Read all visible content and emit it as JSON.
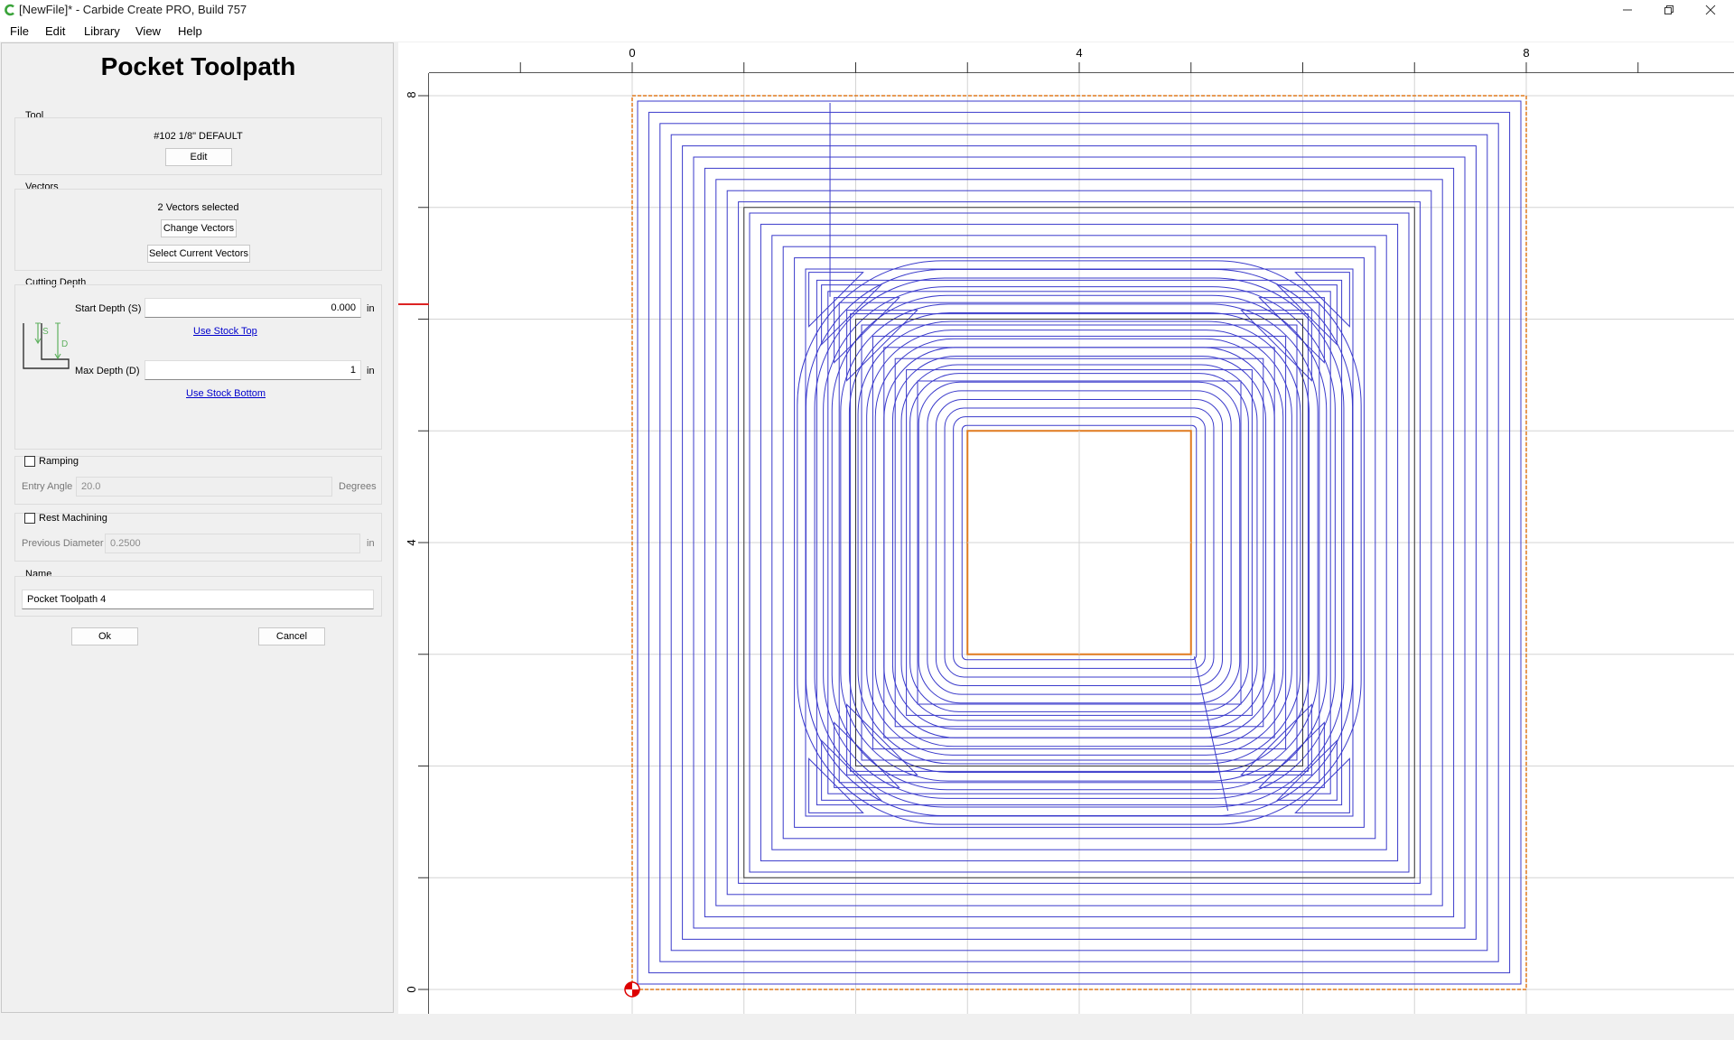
{
  "window": {
    "title": "[NewFile]* - Carbide Create PRO, Build 757",
    "controls": [
      "minimize",
      "restore",
      "close"
    ]
  },
  "menu": {
    "items": [
      "File",
      "Edit",
      "Library",
      "View",
      "Help"
    ]
  },
  "panel": {
    "title": "Pocket Toolpath",
    "tool": {
      "group_label": "Tool",
      "name": "#102 1/8\" DEFAULT",
      "edit_label": "Edit"
    },
    "vectors": {
      "group_label": "Vectors",
      "status": "2 Vectors selected",
      "change_label": "Change Vectors",
      "select_current_label": "Select Current Vectors"
    },
    "cutting_depth": {
      "group_label": "Cutting Depth",
      "start_label": "Start Depth (S)",
      "start_value": "0.000",
      "start_unit": "in",
      "use_stock_top": "Use Stock Top",
      "max_label": "Max Depth (D)",
      "max_value": "1",
      "max_unit": "in",
      "use_stock_bottom": "Use Stock Bottom",
      "diagram_s": "S",
      "diagram_d": "D"
    },
    "ramping": {
      "label": "Ramping",
      "checked": false,
      "entry_angle_label": "Entry Angle",
      "entry_angle_value": "20.0",
      "entry_angle_unit": "Degrees"
    },
    "rest_machining": {
      "label": "Rest Machining",
      "checked": false,
      "previous_diameter_label": "Previous Diameter",
      "previous_diameter_value": "0.2500",
      "previous_diameter_unit": "in"
    },
    "name": {
      "group_label": "Name",
      "value": "Pocket Toolpath 4"
    },
    "ok_label": "Ok",
    "cancel_label": "Cancel"
  },
  "canvas": {
    "ruler_top_labels": [
      "0",
      "4",
      "8"
    ],
    "ruler_left_labels": [
      "8",
      "4",
      "0"
    ],
    "colors": {
      "toolpath": "#3a3acb",
      "stock_border": "#e07a1f",
      "vector": "#e07a1f",
      "grid": "#d4d4d4",
      "origin": "#dd0000"
    }
  }
}
